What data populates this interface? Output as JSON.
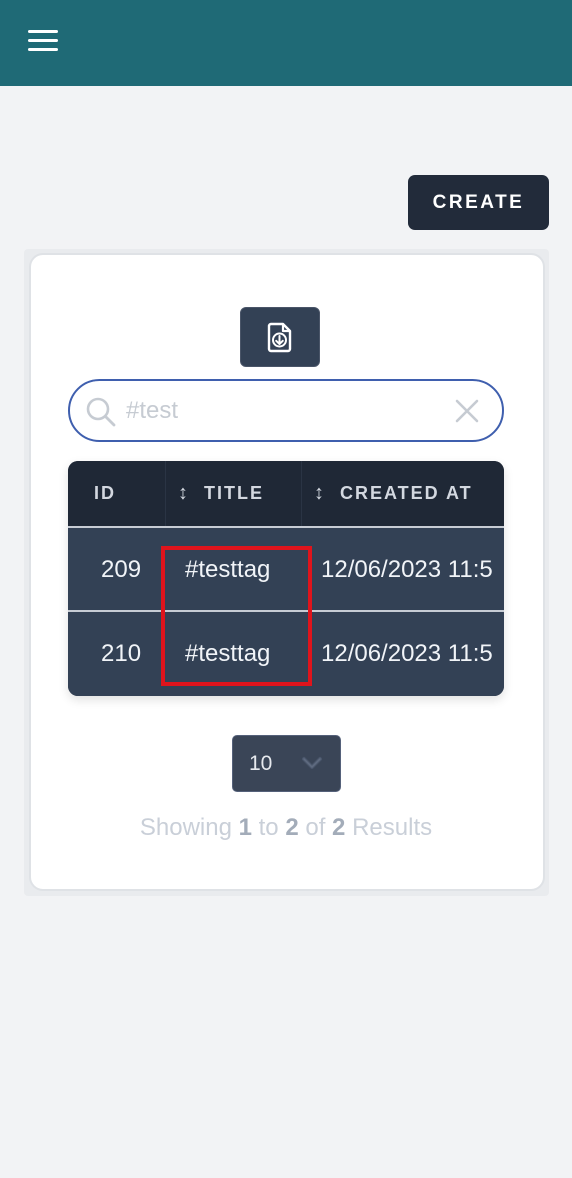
{
  "header": {
    "menu_icon": "hamburger-menu-icon",
    "background": "#1f6a76"
  },
  "actions": {
    "create_label": "CREATE",
    "export_icon": "file-download-icon"
  },
  "search": {
    "placeholder": "#test",
    "search_icon": "search-icon",
    "clear_icon": "close-icon"
  },
  "table": {
    "columns": [
      {
        "label": "ID",
        "sortable": false
      },
      {
        "label": "TITLE",
        "sortable": true
      },
      {
        "label": "CREATED AT",
        "sortable": true
      }
    ],
    "sort_glyph": "↕",
    "rows": [
      {
        "id": "209",
        "title": "#testtag",
        "created_at": "12/06/2023 11:5"
      },
      {
        "id": "210",
        "title": "#testtag",
        "created_at": "12/06/2023 11:5"
      }
    ]
  },
  "pagination": {
    "page_size": "10",
    "showing_prefix": "Showing",
    "from": "1",
    "to_word": "to",
    "to": "2",
    "of_word": "of",
    "total": "2",
    "suffix": "Results"
  },
  "highlight_color": "#e0141c"
}
